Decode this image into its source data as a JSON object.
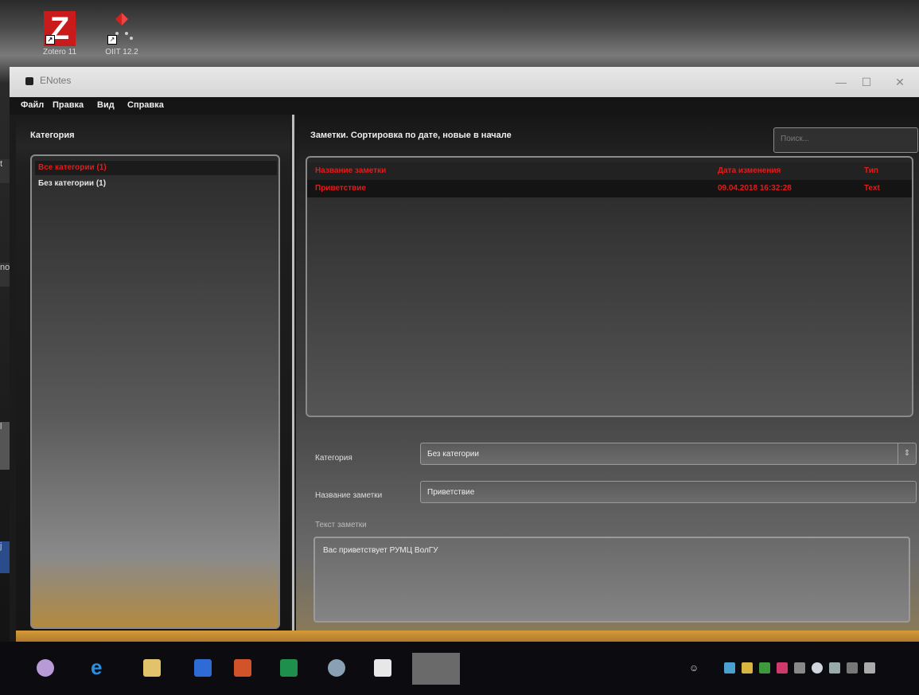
{
  "desktop": {
    "icons": [
      {
        "label": "Zotero 11",
        "glyph": "Z"
      },
      {
        "label": "OIIT 12.2",
        "glyph": "◆"
      }
    ],
    "edge_text": [
      "t",
      "no",
      "l",
      "j"
    ]
  },
  "window": {
    "title": "ENotes",
    "controls": {
      "minimize": "—",
      "maximize": "☐",
      "close": "✕"
    },
    "menu": [
      "Файл",
      "Правка",
      "Вид",
      "Справка"
    ]
  },
  "categories": {
    "header": "Категория",
    "items": [
      {
        "label": "Все категории (1)",
        "selected": true
      },
      {
        "label": "Без категории (1)",
        "selected": false
      }
    ]
  },
  "notes": {
    "title": "Заметки. Сортировка по дате, новые в начале",
    "search_placeholder": "Поиск...",
    "columns": {
      "name": "Название заметки",
      "date": "Дата изменения",
      "type": "Тип"
    },
    "rows": [
      {
        "name": "Приветствие",
        "date": "09.04.2018 16:32:28",
        "type": "Text"
      }
    ]
  },
  "editor": {
    "category_label": "Категория",
    "category_value": "Без категории",
    "name_label": "Название заметки",
    "name_value": "Приветствие",
    "text_label": "Текст заметки",
    "text_value": "Вас приветствует РУМЦ ВолГУ"
  },
  "taskbar": {
    "apps": [
      "cortana-icon",
      "edge-icon",
      "file-explorer-icon",
      "word-icon",
      "powerpoint-icon",
      "excel-icon",
      "paint-icon",
      "acrobat-icon",
      "enotes-icon"
    ],
    "tray": [
      "people-icon",
      "notes-icon",
      "tools-icon",
      "download-icon",
      "app-icon",
      "usb-icon",
      "shield-icon",
      "network-icon",
      "chat-icon",
      "desktop-icon"
    ]
  },
  "colors": {
    "accent_red": "#e11c1c",
    "orange": "#d49a3a"
  }
}
